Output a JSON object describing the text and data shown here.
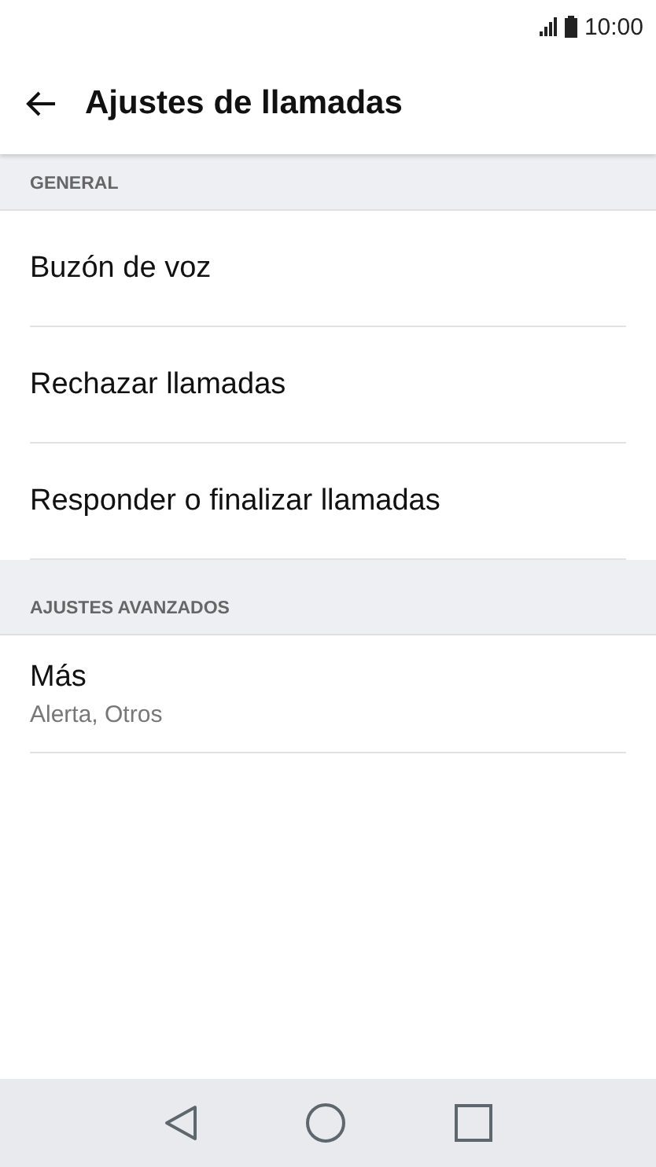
{
  "status_bar": {
    "time": "10:00"
  },
  "header": {
    "title": "Ajustes de llamadas"
  },
  "sections": [
    {
      "title": "GENERAL",
      "items": [
        {
          "title": "Buzón de voz"
        },
        {
          "title": "Rechazar llamadas"
        },
        {
          "title": "Responder o finalizar llamadas"
        }
      ]
    },
    {
      "title": "AJUSTES AVANZADOS",
      "items": [
        {
          "title": "Más",
          "subtitle": "Alerta, Otros"
        }
      ]
    }
  ]
}
